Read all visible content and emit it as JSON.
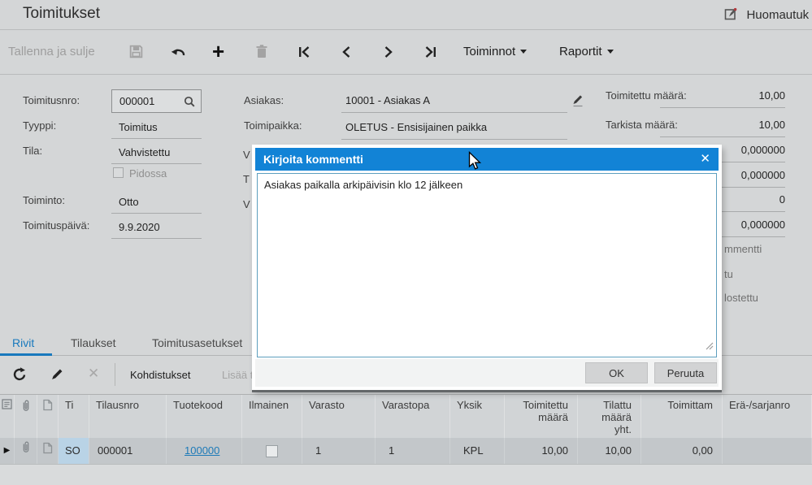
{
  "window": {
    "title": "Toimitukset"
  },
  "top_right": {
    "notes_label": "Huomautuk"
  },
  "toolbar": {
    "save_and_close": "Tallenna ja sulje",
    "actions_menu": "Toiminnot",
    "reports_menu": "Raportit"
  },
  "form": {
    "left": {
      "shipment_nbr_label": "Toimitusnro:",
      "shipment_nbr": "000001",
      "type_label": "Tyyppi:",
      "type_value": "Toimitus",
      "status_label": "Tila:",
      "status_value": "Vahvistettu",
      "hold_label": "Pidossa",
      "operation_label": "Toiminto:",
      "operation_value": "Otto",
      "date_label": "Toimituspäivä:",
      "date_value": "9.9.2020"
    },
    "middle": {
      "customer_label": "Asiakas:",
      "customer_value": "10001 - Asiakas A",
      "location_label": "Toimipaikka:",
      "location_value": "OLETUS - Ensisijainen paikka",
      "clipped_label_1": "V",
      "clipped_label_2": "T",
      "clipped_label_3": "V"
    },
    "right": {
      "shipped_qty_label": "Toimitettu määrä:",
      "shipped_qty": "10,00",
      "control_qty_label": "Tarkista määrä:",
      "control_qty": "10,00",
      "value_3": "0,000000",
      "value_4": "0,000000",
      "value_5": "0",
      "value_6": "0,000000",
      "clipped_label_1": "mmentti",
      "clipped_label_2": "tu",
      "clipped_label_3": "lostettu"
    }
  },
  "dialog": {
    "title": "Kirjoita kommentti",
    "close_glyph": "✕",
    "comment": "Asiakas paikalla arkipäivisin klo 12 jälkeen",
    "ok_label": "OK",
    "cancel_label": "Peruuta"
  },
  "tabs": {
    "rows": "Rivit",
    "orders": "Tilaukset",
    "shipment_settings": "Toimitusasetukset"
  },
  "grid_toolbar": {
    "allocations_label": "Kohdistukset",
    "clipped_label": "Lisää ti"
  },
  "grid": {
    "headers": {
      "ti": "Ti",
      "order_nbr": "Tilausnro",
      "item": "Tuotekood",
      "free": "Ilmainen",
      "warehouse": "Varasto",
      "location": "Varastopa",
      "uom": "Yksik",
      "shipped_qty": "Toimitettu määrä",
      "ordered_qty": "Tilattu määrä yht.",
      "open_qty": "Toimittam",
      "lot_serial": "Erä-/sarjanro"
    },
    "row": {
      "ti": "SO",
      "order_nbr": "000001",
      "item": "100000",
      "warehouse": "1",
      "location": "1",
      "uom": "KPL",
      "shipped_qty": "10,00",
      "ordered_qty": "10,00",
      "open_qty": "0,00",
      "lot_serial": ""
    }
  },
  "colors": {
    "dialog_header_blue": "#1283d6",
    "tab_active_blue": "#1879bd",
    "link_blue": "#1d7ab8",
    "selected_row_gray": "#c3c7ca",
    "ti_cell_blue": "#b9d3e6"
  }
}
